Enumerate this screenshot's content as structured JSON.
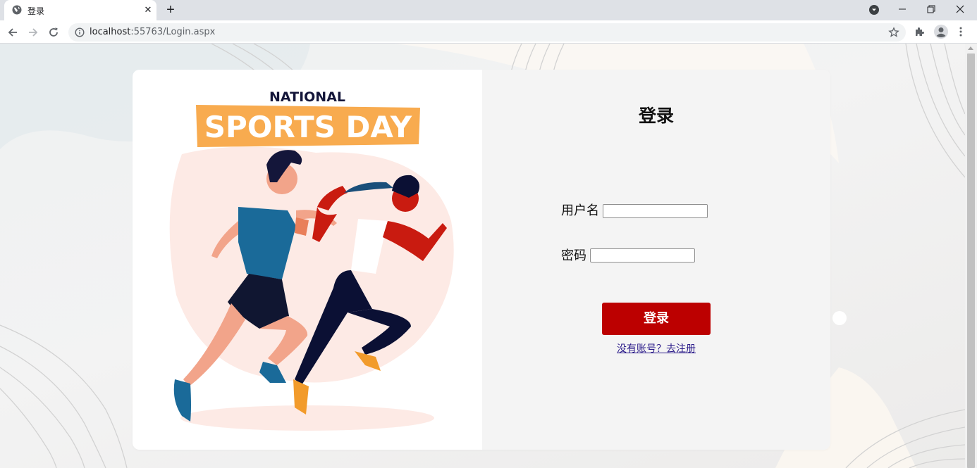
{
  "browser": {
    "tab_title": "登录",
    "url_host": "localhost",
    "url_path": ":55763/Login.aspx"
  },
  "illustration": {
    "heading_top": "NATIONAL",
    "heading_banner": "SPORTS DAY"
  },
  "login": {
    "title": "登录",
    "username_label": "用户名",
    "username_value": "",
    "password_label": "密码",
    "password_value": "",
    "submit_label": "登录",
    "register_link": "没有账号？去注册"
  },
  "colors": {
    "submit_button": "#bc0000",
    "banner": "#f8ab4f",
    "form_panel": "#f4f4f4",
    "link": "#2b1b8a"
  }
}
